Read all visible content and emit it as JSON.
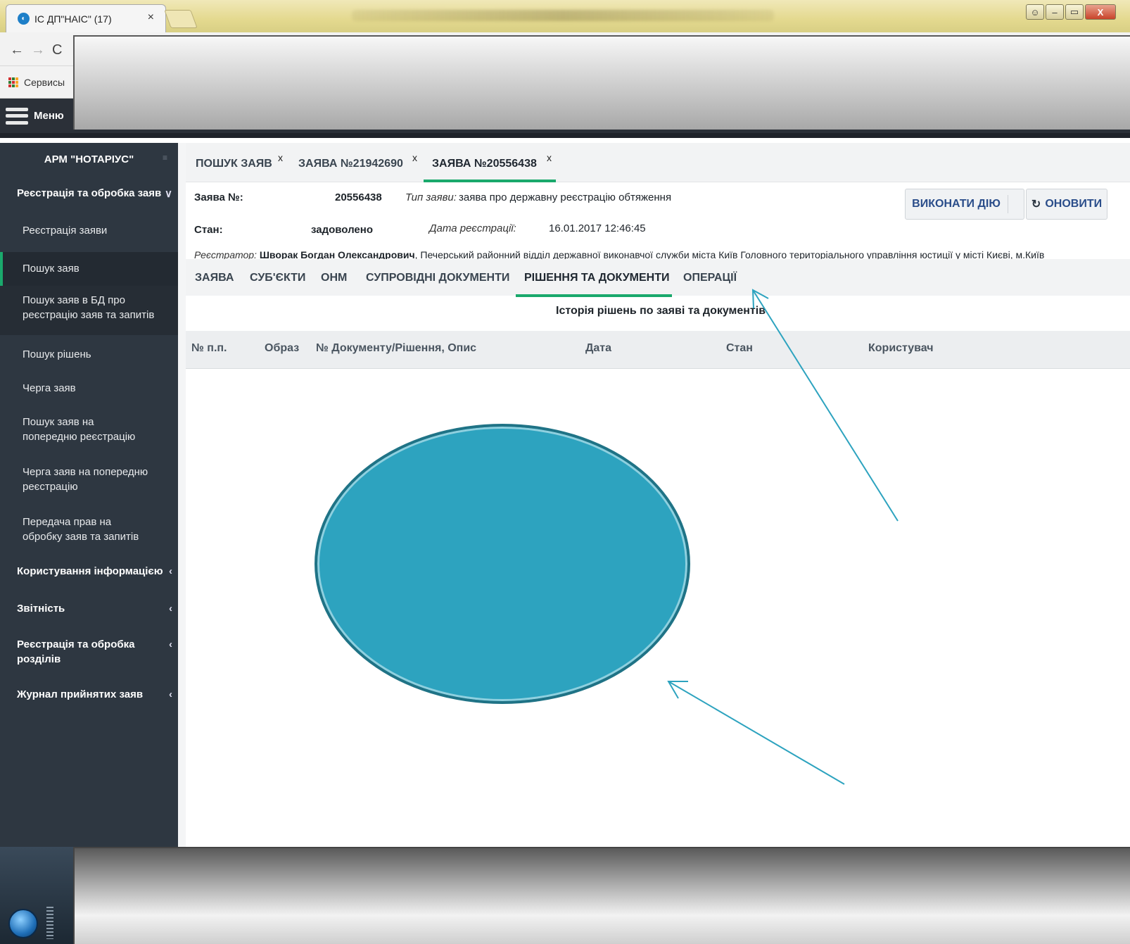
{
  "browser": {
    "tab_title": "ІС ДП\"НАІС\" (17)",
    "tab_close": "×",
    "nav_back": "←",
    "nav_forward": "→",
    "nav_reload": "C",
    "bookmark_label": "Сервисы",
    "window_close": "X",
    "window_minimize": "–",
    "window_restore": "▭",
    "window_user": "☺"
  },
  "header": {
    "menu_label": "Меню"
  },
  "sidebar": {
    "brand": "АРМ \"НОТАРІУС\"",
    "toggle": "≡",
    "section_main": "Реєстрація та обробка заяв",
    "section_main_chevron": "∨",
    "items": [
      "Реєстрація заяви",
      "Пошук заяв",
      "Пошук заяв в БД про реєстрацію заяв та запитів",
      "Пошук рішень",
      "Черга заяв",
      "Пошук заяв на попередню реєстрацію",
      "Черга заяв на попередню реєстрацію",
      "Передача прав на обробку заяв та запитів"
    ],
    "sections": [
      "Користування інформацією",
      "Звітність",
      "Реєстрація та обробка розділів",
      "Журнал прийнятих заяв"
    ],
    "section_chevron": "‹"
  },
  "tabs": [
    {
      "label": "ПОШУК ЗАЯВ",
      "close": "x"
    },
    {
      "label": "ЗАЯВА №21942690",
      "close": "x"
    },
    {
      "label": "ЗАЯВА №20556438",
      "close": "x"
    }
  ],
  "application": {
    "number_label": "Заява №:",
    "number_value": "20556438",
    "type_label": "Тип заяви:",
    "type_value": "заява про державну реєстрацію обтяження",
    "status_label": "Стан:",
    "status_value": "задоволено",
    "date_label": "Дата реєстрації:",
    "date_value": "16.01.2017 12:46:45",
    "registrar_label": "Реєстратор:",
    "registrar_name": "Шворак Богдан Олександрович",
    "registrar_org": ", Печерський районний відділ державної виконавчої служби міста Київ Головного територіального управління юстиції у місті Києві, м.Київ"
  },
  "actions": {
    "execute_label": "ВИКОНАТИ ДІЮ",
    "refresh_icon": "↻",
    "refresh_label": "ОНОВИТИ"
  },
  "subtabs": [
    "ЗАЯВА",
    "СУБ'ЄКТИ",
    "ОНМ",
    "СУПРОВІДНІ ДОКУМЕНТИ",
    "РІШЕННЯ ТА ДОКУМЕНТИ",
    "ОПЕРАЦІЇ"
  ],
  "history": {
    "title": "Історія рішень по заяві та документів",
    "columns": [
      "№ п.п.",
      "Образ",
      "№ Документу/Рішення, Опис",
      "Дата",
      "Стан",
      "Користувач"
    ]
  },
  "colors": {
    "accent": "#1aa96c",
    "sidebar_bg": "#2e3741",
    "annotation": "#2da3bf"
  }
}
